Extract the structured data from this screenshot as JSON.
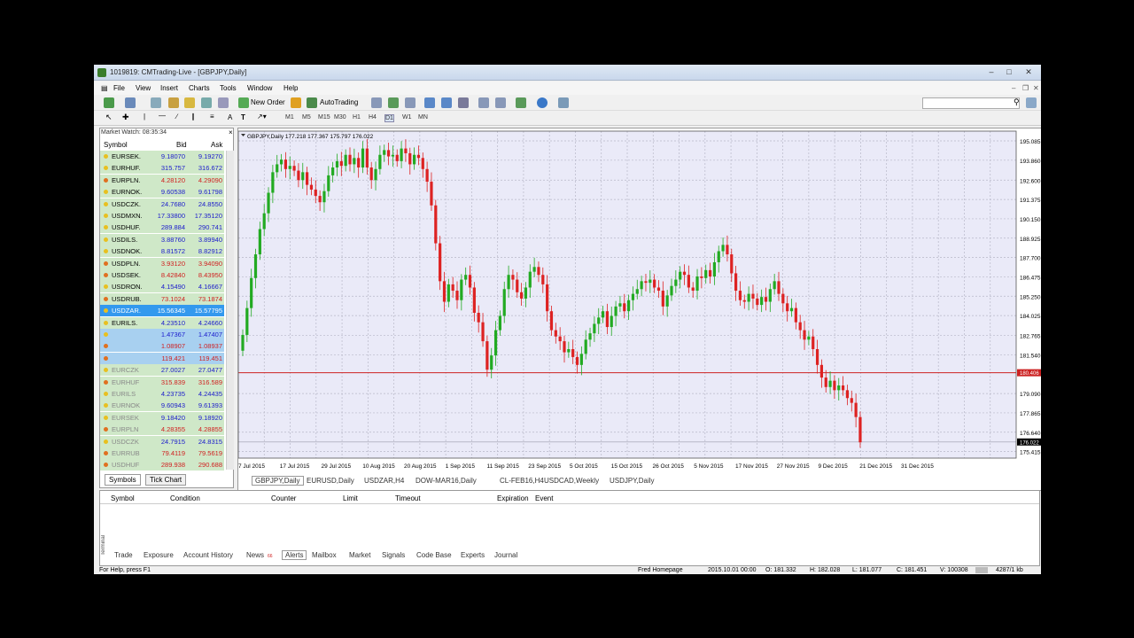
{
  "window": {
    "title": "1019819: CMTrading-Live - [GBPJPY,Daily]"
  },
  "menu": [
    "File",
    "View",
    "Insert",
    "Charts",
    "Tools",
    "Window",
    "Help"
  ],
  "toolbar": {
    "new_order": "New Order",
    "autotrading": "AutoTrading"
  },
  "timeframes": [
    "M1",
    "M5",
    "M15",
    "M30",
    "H1",
    "H4",
    "D1",
    "W1",
    "MN"
  ],
  "market_watch": {
    "title": "Market Watch: 08:35:34",
    "col_symbol": "Symbol",
    "col_bid": "Bid",
    "col_ask": "Ask",
    "rows": [
      {
        "symbol": "EURSEK.",
        "bid": "9.18070",
        "ask": "9.19270",
        "color": "#1a1acc",
        "bg": "#cfe8c8"
      },
      {
        "symbol": "EURHUF.",
        "bid": "315.757",
        "ask": "316.672",
        "color": "#1a1acc",
        "bg": "#cfe8c8"
      },
      {
        "symbol": "EURPLN.",
        "bid": "4.28120",
        "ask": "4.29090",
        "color": "#d02020",
        "bg": "#cfe8c8"
      },
      {
        "symbol": "EURNOK.",
        "bid": "9.60538",
        "ask": "9.61798",
        "color": "#1a1acc",
        "bg": "#cfe8c8"
      },
      {
        "symbol": "USDCZK.",
        "bid": "24.7680",
        "ask": "24.8550",
        "color": "#1a1acc",
        "bg": "#cfe8c8"
      },
      {
        "symbol": "USDMXN.",
        "bid": "17.33800",
        "ask": "17.35120",
        "color": "#1a1acc",
        "bg": "#cfe8c8"
      },
      {
        "symbol": "USDHUF.",
        "bid": "289.884",
        "ask": "290.741",
        "color": "#1a1acc",
        "bg": "#cfe8c8"
      },
      {
        "symbol": "USDILS.",
        "bid": "3.88760",
        "ask": "3.89940",
        "color": "#1a1acc",
        "bg": "#cfe8c8"
      },
      {
        "symbol": "USDNOK.",
        "bid": "8.81572",
        "ask": "8.82912",
        "color": "#1a1acc",
        "bg": "#cfe8c8"
      },
      {
        "symbol": "USDPLN.",
        "bid": "3.93120",
        "ask": "3.94090",
        "color": "#d02020",
        "bg": "#cfe8c8"
      },
      {
        "symbol": "USDSEK.",
        "bid": "8.42840",
        "ask": "8.43950",
        "color": "#d02020",
        "bg": "#cfe8c8"
      },
      {
        "symbol": "USDRON.",
        "bid": "4.15490",
        "ask": "4.16667",
        "color": "#1a1acc",
        "bg": "#cfe8c8"
      },
      {
        "symbol": "USDRUB.",
        "bid": "73.1024",
        "ask": "73.1874",
        "color": "#d02020",
        "bg": "#cfe8c8"
      },
      {
        "symbol": "USDZAR.",
        "bid": "15.56345",
        "ask": "15.57795",
        "color": "#ffffff",
        "bg": "#3399ee"
      },
      {
        "symbol": "EURILS.",
        "bid": "4.23510",
        "ask": "4.24660",
        "color": "#1a1acc",
        "bg": "#cfe8c8"
      },
      {
        "symbol": "",
        "bid": "1.47367",
        "ask": "1.47407",
        "color": "#1a1acc",
        "bg": "#a8d0f0"
      },
      {
        "symbol": "",
        "bid": "1.08907",
        "ask": "1.08937",
        "color": "#d02020",
        "bg": "#a8d0f0"
      },
      {
        "symbol": "",
        "bid": "119.421",
        "ask": "119.451",
        "color": "#d02020",
        "bg": "#a8d0f0"
      },
      {
        "symbol": "EURCZK",
        "bid": "27.0027",
        "ask": "27.0477",
        "color": "#1a1acc",
        "bg": "#cfe8c8",
        "dim": true
      },
      {
        "symbol": "EURHUF",
        "bid": "315.839",
        "ask": "316.589",
        "color": "#d02020",
        "bg": "#cfe8c8",
        "dim": true
      },
      {
        "symbol": "EURILS",
        "bid": "4.23735",
        "ask": "4.24435",
        "color": "#1a1acc",
        "bg": "#cfe8c8",
        "dim": true
      },
      {
        "symbol": "EURNOK",
        "bid": "9.60943",
        "ask": "9.61393",
        "color": "#1a1acc",
        "bg": "#cfe8c8",
        "dim": true
      },
      {
        "symbol": "EURSEK",
        "bid": "9.18420",
        "ask": "9.18920",
        "color": "#1a1acc",
        "bg": "#cfe8c8",
        "dim": true
      },
      {
        "symbol": "EURPLN",
        "bid": "4.28355",
        "ask": "4.28855",
        "color": "#d02020",
        "bg": "#cfe8c8",
        "dim": true
      },
      {
        "symbol": "USDCZK",
        "bid": "24.7915",
        "ask": "24.8315",
        "color": "#1a1acc",
        "bg": "#cfe8c8",
        "dim": true
      },
      {
        "symbol": "EURRUB",
        "bid": "79.4119",
        "ask": "79.5619",
        "color": "#d02020",
        "bg": "#cfe8c8",
        "dim": true
      },
      {
        "symbol": "USDHUF",
        "bid": "289.938",
        "ask": "290.688",
        "color": "#d02020",
        "bg": "#cfe8c8",
        "dim": true
      }
    ],
    "tabs": [
      "Symbols",
      "Tick Chart"
    ]
  },
  "chart_tabs": [
    "GBPJPY,Daily",
    "EURUSD,Daily",
    "USDZAR,H4",
    "DOW-MAR16,Daily",
    "CL-FEB16,H4",
    "USDCAD,Weekly",
    "USDJPY,Daily"
  ],
  "chart_data": {
    "type": "candlestick",
    "header": "GBPJPY,Daily  177.218 177.367 175.797 176.022",
    "price_axis": [
      "195.085",
      "193.860",
      "192.600",
      "191.375",
      "190.150",
      "188.925",
      "187.700",
      "186.475",
      "185.250",
      "184.025",
      "182.765",
      "181.540",
      "180.406",
      "179.090",
      "177.865",
      "176.640",
      "175.415"
    ],
    "ylim": [
      175.0,
      195.7
    ],
    "current_line": 180.406,
    "current_label": "180.406",
    "last_price": "176.022",
    "x_labels": [
      "7 Jul 2015",
      "17 Jul 2015",
      "29 Jul 2015",
      "10 Aug 2015",
      "20 Aug 2015",
      "1 Sep 2015",
      "11 Sep 2015",
      "23 Sep 2015",
      "5 Oct 2015",
      "15 Oct 2015",
      "26 Oct 2015",
      "5 Nov 2015",
      "17 Nov 2015",
      "27 Nov 2015",
      "9 Dec 2015",
      "21 Dec 2015",
      "31 Dec 2015"
    ],
    "closes": [
      182.8,
      184.5,
      186.4,
      187.9,
      189.5,
      190.5,
      191.8,
      193.1,
      193.6,
      193.9,
      193.3,
      193.5,
      193.2,
      192.6,
      193.1,
      192.3,
      192.0,
      191.6,
      191.2,
      191.9,
      192.9,
      193.4,
      193.8,
      193.5,
      194.2,
      193.6,
      194.0,
      193.4,
      194.6,
      193.4,
      192.6,
      193.3,
      194.2,
      194.5,
      194.1,
      194.2,
      193.8,
      194.6,
      194.3,
      193.6,
      194.2,
      194.0,
      193.3,
      192.5,
      191.0,
      188.6,
      186.2,
      184.9,
      186.0,
      185.6,
      185.0,
      186.3,
      186.6,
      185.8,
      184.2,
      183.6,
      182.4,
      180.6,
      181.5,
      183.1,
      184.0,
      185.7,
      186.6,
      186.3,
      185.5,
      185.1,
      185.8,
      186.8,
      187.1,
      186.6,
      186.0,
      184.3,
      183.1,
      182.7,
      182.4,
      181.7,
      181.9,
      181.4,
      180.9,
      181.6,
      182.5,
      182.9,
      183.5,
      183.9,
      184.3,
      183.3,
      184.0,
      184.6,
      184.8,
      184.3,
      185.0,
      185.4,
      185.7,
      186.2,
      186.1,
      186.3,
      185.8,
      185.6,
      184.6,
      185.3,
      185.9,
      186.3,
      186.8,
      186.6,
      185.8,
      185.6,
      186.5,
      186.4,
      186.9,
      186.5,
      187.4,
      188.1,
      188.5,
      187.9,
      186.7,
      185.6,
      185.0,
      184.9,
      185.4,
      185.1,
      184.7,
      185.2,
      184.9,
      185.7,
      186.2,
      185.4,
      184.8,
      184.3,
      184.5,
      183.6,
      183.1,
      182.5,
      182.7,
      181.9,
      180.9,
      180.1,
      179.5,
      179.9,
      179.3,
      179.6,
      179.3,
      178.8,
      178.5,
      177.6,
      176.0
    ]
  },
  "terminal": {
    "cols": [
      "Symbol",
      "Condition",
      "Counter",
      "Limit",
      "Timeout",
      "Expiration",
      "Event"
    ],
    "tabs": [
      "Trade",
      "Exposure",
      "Account History",
      "News",
      "Alerts",
      "Mailbox",
      "Market",
      "Signals",
      "Code Base",
      "Experts",
      "Journal"
    ],
    "news_badge": "66",
    "side_label": "Terminal"
  },
  "status": {
    "help": "For Help, press F1",
    "profile": "Fred Homepage",
    "time": "2015.10.01 00:00",
    "open": "O: 181.332",
    "high": "H: 182.028",
    "low": "L: 181.077",
    "close": "C: 181.451",
    "volume": "V: 100308",
    "traffic": "4287/1 kb"
  },
  "colors": {
    "bull": "#22aa22",
    "bear": "#dd2222",
    "chart_bg": "#eaeaf8",
    "grid": "#b8b8c8"
  }
}
